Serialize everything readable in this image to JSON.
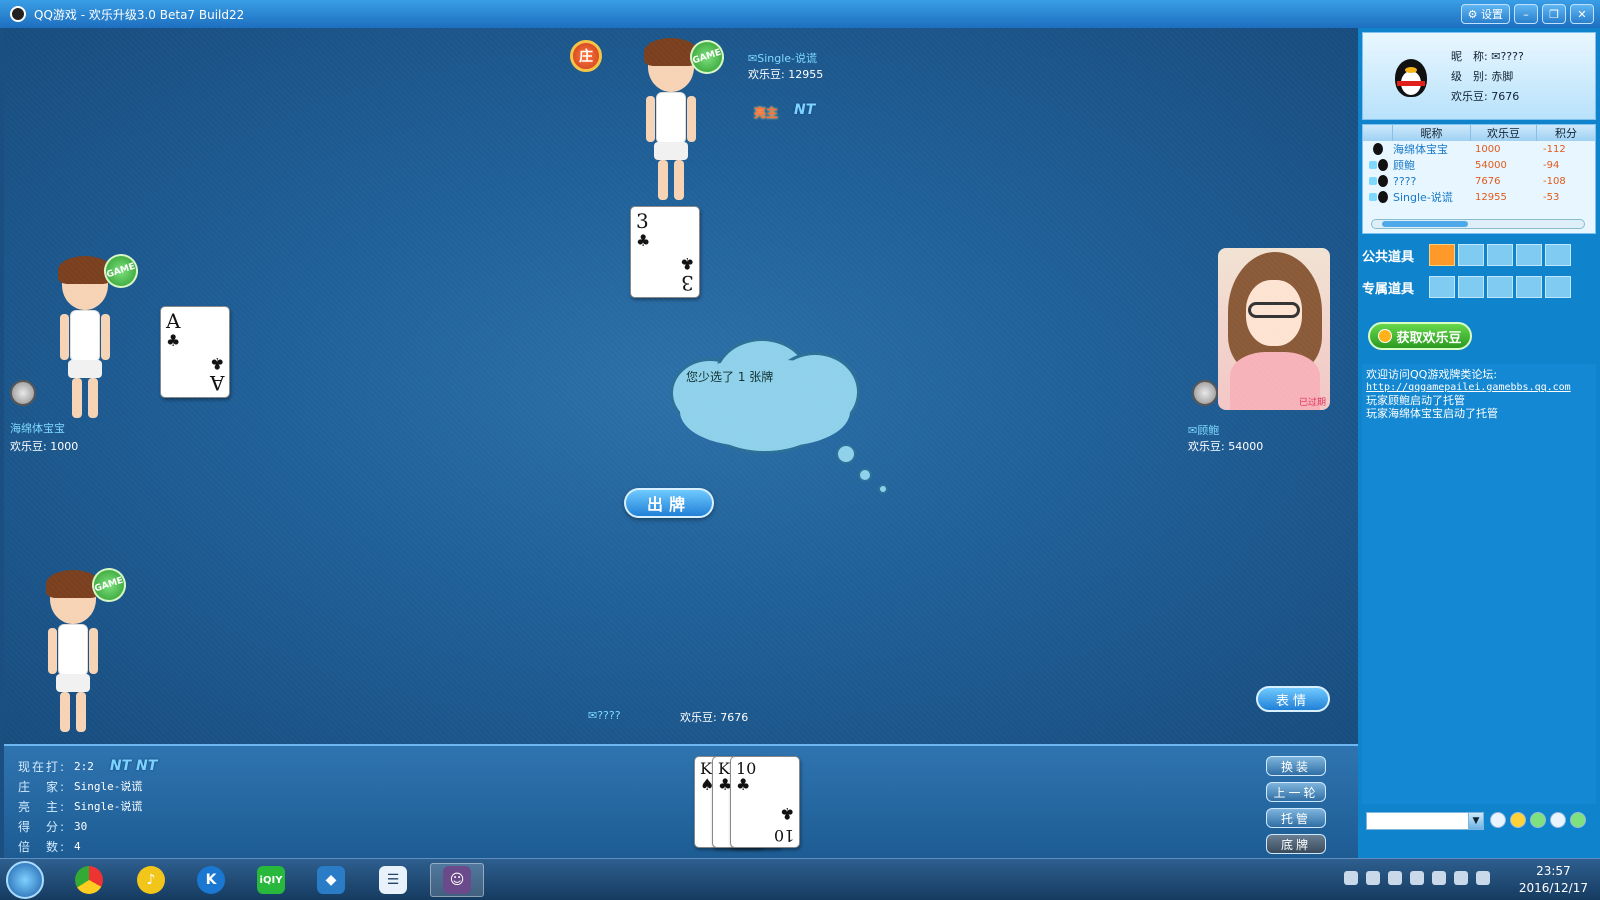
{
  "titlebar": {
    "title": "QQ游戏 - 欢乐升级3.0 Beta7 Build22",
    "settings_label": "设置"
  },
  "table": {
    "zhuang_badge": "庄",
    "liangzhu_label": "亮主",
    "top_nt": "NT",
    "game_badge": "GAME",
    "players": {
      "top": {
        "name": "Single-说谎",
        "beans": "欢乐豆: 12955"
      },
      "left": {
        "name": "海绵体宝宝",
        "beans": "欢乐豆: 1000"
      },
      "right": {
        "name": "顾鲍",
        "beans": "欢乐豆: 54000"
      },
      "self": {
        "name": "????",
        "beans": "欢乐豆: 7676"
      }
    },
    "cards": {
      "top": {
        "rank": "3",
        "suit": "♣"
      },
      "left": {
        "rank": "A",
        "suit": "♣"
      }
    },
    "hand": [
      {
        "rank": "K",
        "suit": "♠"
      },
      {
        "rank": "K",
        "suit": "♣"
      },
      {
        "rank": "10",
        "suit": "♣"
      }
    ],
    "cloud_message": "您少选了 1 张牌",
    "play_button": "出牌",
    "emote_button": "表情",
    "girl_tag": "已过期"
  },
  "bottom_info": {
    "rows": [
      {
        "k": "现在打:",
        "v": "2:2"
      },
      {
        "k": "庄　家:",
        "v": "Single-说谎"
      },
      {
        "k": "亮　主:",
        "v": "Single-说谎"
      },
      {
        "k": "得　分:",
        "v": "30"
      },
      {
        "k": "倍　数:",
        "v": "4"
      }
    ],
    "nt_pair": "NT NT"
  },
  "side_buttons": [
    "换装",
    "上一轮",
    "托管",
    "底牌"
  ],
  "right_panel": {
    "profile": {
      "nick_label": "昵　称:",
      "nick": "????",
      "level_label": "级　别:",
      "level": "赤脚",
      "beans_label": "欢乐豆:",
      "beans": "7676"
    },
    "table_head": [
      "",
      "昵称",
      "欢乐豆",
      "积分"
    ],
    "rows": [
      {
        "name": "海绵体宝宝",
        "beans": "1000",
        "score": "-112"
      },
      {
        "name": "顾鲍",
        "beans": "54000",
        "score": "-94"
      },
      {
        "name": "????",
        "beans": "7676",
        "score": "-108"
      },
      {
        "name": "Single-说谎",
        "beans": "12955",
        "score": "-53"
      }
    ],
    "public_props": "公共道具",
    "private_props": "专属道具",
    "get_beans": "获取欢乐豆",
    "chat": {
      "welcome": "欢迎访问QQ游戏牌类论坛:",
      "link": "http://qqgamepailei.gamebbs.qq.com",
      "msg1": "玩家顾鲍启动了托管",
      "msg2": "玩家海绵体宝宝启动了托管"
    }
  },
  "taskbar": {
    "icons": [
      "chrome-icon",
      "music-icon",
      "kugou-icon",
      "iqiyi-icon",
      "qq-game-icon",
      "messenger-icon",
      "game-window-icon"
    ],
    "time": "23:57",
    "date": "2016/12/17"
  }
}
